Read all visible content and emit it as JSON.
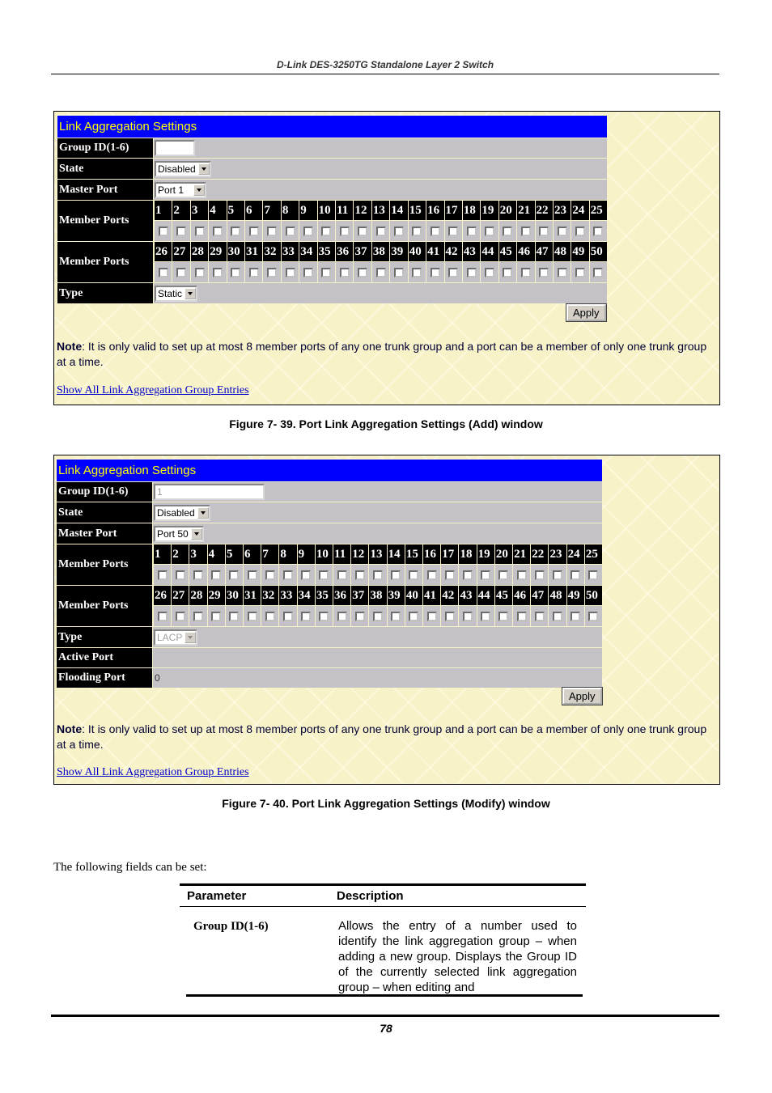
{
  "document": {
    "running_header": "D-Link DES-3250TG Standalone Layer 2 Switch",
    "page_number": "78"
  },
  "ports_row1": [
    "1",
    "2",
    "3",
    "4",
    "5",
    "6",
    "7",
    "8",
    "9",
    "10",
    "11",
    "12",
    "13",
    "14",
    "15",
    "16",
    "17",
    "18",
    "19",
    "20",
    "21",
    "22",
    "23",
    "24",
    "25"
  ],
  "ports_row2": [
    "26",
    "27",
    "28",
    "29",
    "30",
    "31",
    "32",
    "33",
    "34",
    "35",
    "36",
    "37",
    "38",
    "39",
    "40",
    "41",
    "42",
    "43",
    "44",
    "45",
    "46",
    "47",
    "48",
    "49",
    "50"
  ],
  "add_window": {
    "title": "Link Aggregation Settings",
    "fields": {
      "group_id_label": "Group ID(1-6)",
      "group_id_value": "",
      "state_label": "State",
      "state_value": "Disabled",
      "master_port_label": "Master Port",
      "master_port_value": "Port 1",
      "member_ports_label": "Member Ports",
      "type_label": "Type",
      "type_value": "Static"
    },
    "apply_label": "Apply",
    "note_prefix": "Note",
    "note_text": ": It is only valid to set up at most 8 member ports of any one trunk group and a port can be a member of only one trunk group at a time.",
    "link_text": "Show All Link Aggregation Group Entries",
    "caption": "Figure 7- 39.  Port Link Aggregation Settings (Add) window"
  },
  "modify_window": {
    "title": "Link Aggregation Settings",
    "fields": {
      "group_id_label": "Group ID(1-6)",
      "group_id_value": "1",
      "state_label": "State",
      "state_value": "Disabled",
      "master_port_label": "Master Port",
      "master_port_value": "Port 50",
      "member_ports_label": "Member Ports",
      "type_label": "Type",
      "type_value": "LACP",
      "active_port_label": "Active Port",
      "active_port_value": "",
      "flooding_port_label": "Flooding Port",
      "flooding_port_value": "0"
    },
    "apply_label": "Apply",
    "note_prefix": "Note",
    "note_text": ": It is only valid to set up at most 8 member ports of any one trunk group and a port can be a member of only one trunk group at a time.",
    "link_text": "Show All Link Aggregation Group Entries",
    "caption": "Figure 7- 40.  Port Link Aggregation Settings (Modify) window"
  },
  "body": {
    "intro": "The following fields can be set:",
    "param_table": {
      "headers": [
        "Parameter",
        "Description"
      ],
      "rows": [
        {
          "parameter": "Group ID(1-6)",
          "description": "Allows the entry of a number used to identify the link aggregation group – when adding a new group. Displays the Group ID of the currently selected link aggregation group – when editing and"
        }
      ]
    }
  }
}
